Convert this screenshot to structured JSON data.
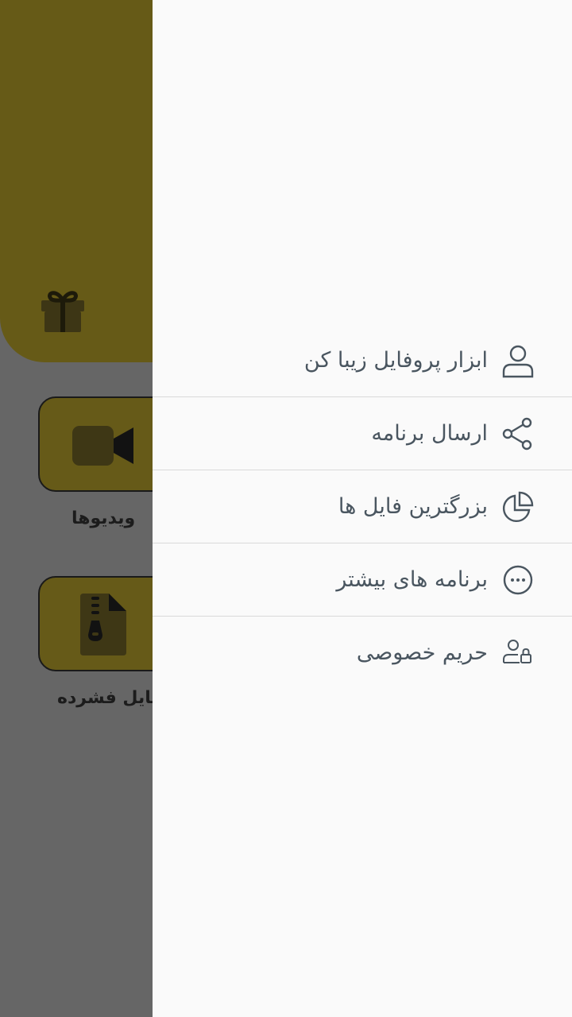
{
  "background": {
    "tiles": [
      {
        "label": "ویدیوها",
        "icon": "video-camera-icon"
      },
      {
        "label": "فایل فشرده",
        "icon": "zip-file-icon"
      }
    ],
    "header_icon": "gift-icon",
    "accent_color": "#665a17"
  },
  "drawer": {
    "items": [
      {
        "label": "ابزار پروفایل زیبا کن",
        "icon": "user-icon"
      },
      {
        "label": "ارسال برنامه",
        "icon": "share-icon"
      },
      {
        "label": "بزرگترین فایل ها",
        "icon": "pie-chart-icon"
      },
      {
        "label": "برنامه های بیشتر",
        "icon": "more-dots-icon"
      },
      {
        "label": "حریم خصوصی",
        "icon": "user-lock-icon"
      }
    ],
    "text_color": "#4a5660"
  }
}
